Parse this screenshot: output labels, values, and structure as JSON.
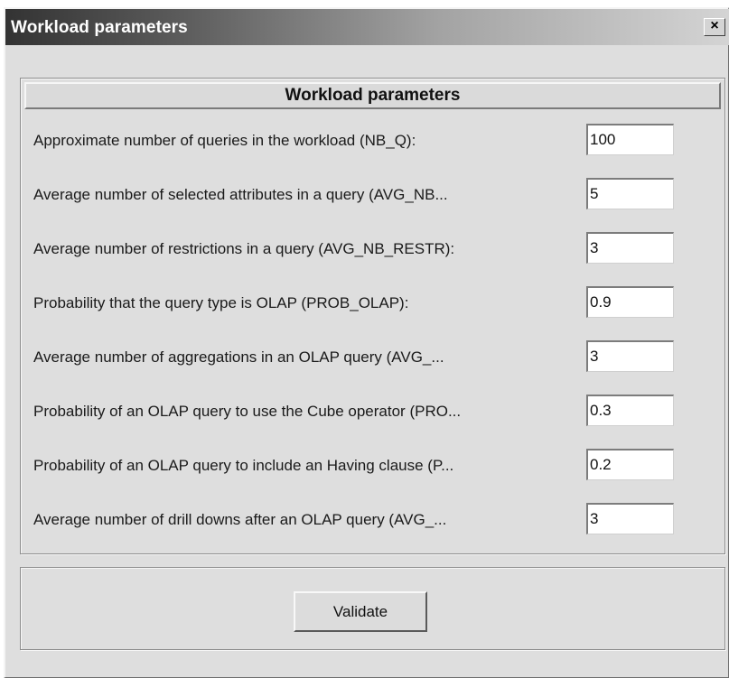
{
  "window": {
    "title": "Workload parameters",
    "close_glyph": "×",
    "close_icon": "close-icon"
  },
  "panel": {
    "header": "Workload parameters"
  },
  "params": [
    {
      "label": "Approximate number of queries in the workload (NB_Q):",
      "value": "100"
    },
    {
      "label": "Average number of selected attributes in a query (AVG_NB...",
      "value": "5"
    },
    {
      "label": "Average number of restrictions in a query (AVG_NB_RESTR):",
      "value": "3"
    },
    {
      "label": "Probability that the query type is OLAP (PROB_OLAP):",
      "value": "0.9"
    },
    {
      "label": "Average number of aggregations in an OLAP query (AVG_...",
      "value": "3"
    },
    {
      "label": "Probability of an OLAP query to use the Cube operator (PRO...",
      "value": "0.3"
    },
    {
      "label": "Probability of an OLAP query to include an Having clause (P...",
      "value": "0.2"
    },
    {
      "label": "Average number of drill downs after an OLAP query (AVG_...",
      "value": "3"
    }
  ],
  "actions": {
    "validate_label": "Validate"
  }
}
